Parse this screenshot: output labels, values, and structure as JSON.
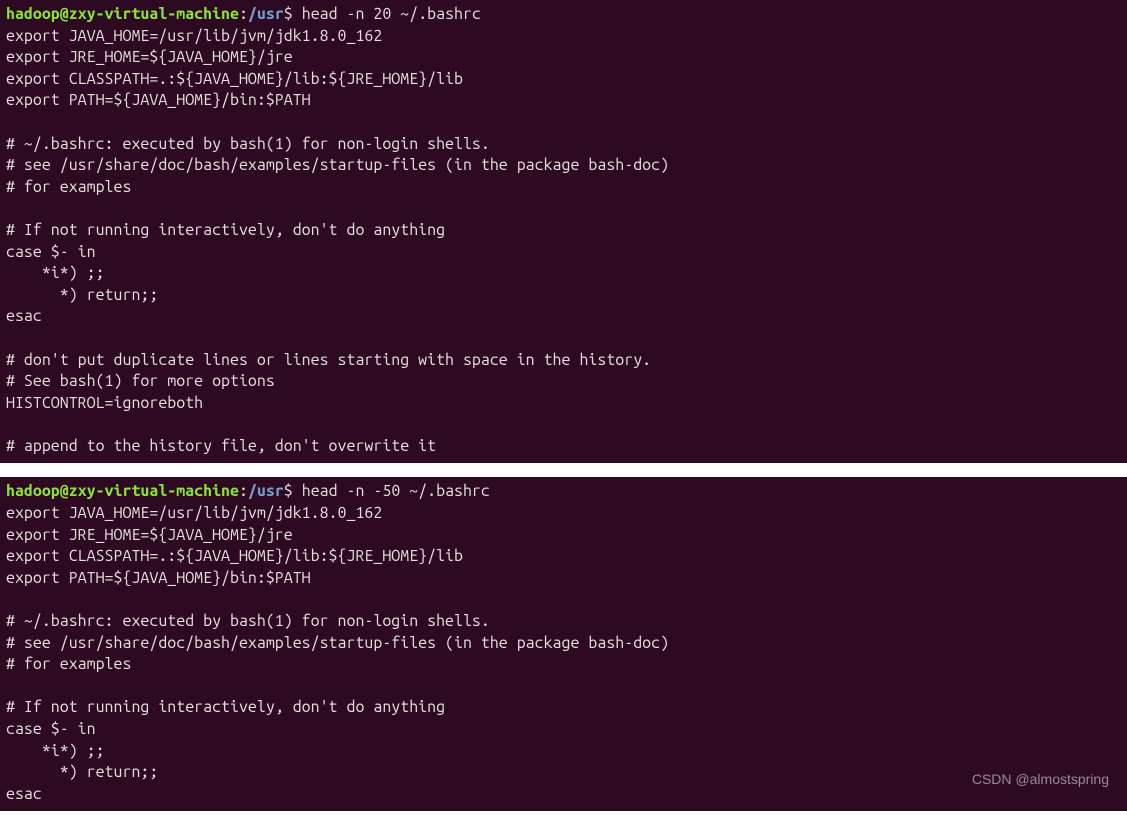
{
  "prompt": {
    "user": "hadoop",
    "at": "@",
    "host": "zxy-virtual-machine",
    "colon": ":",
    "path": "/usr",
    "dollar": "$"
  },
  "terminal1": {
    "command": "head -n 20 ~/.bashrc",
    "lines": [
      "export JAVA_HOME=/usr/lib/jvm/jdk1.8.0_162",
      "export JRE_HOME=${JAVA_HOME}/jre",
      "export CLASSPATH=.:${JAVA_HOME}/lib:${JRE_HOME}/lib",
      "export PATH=${JAVA_HOME}/bin:$PATH",
      "",
      "# ~/.bashrc: executed by bash(1) for non-login shells.",
      "# see /usr/share/doc/bash/examples/startup-files (in the package bash-doc)",
      "# for examples",
      "",
      "# If not running interactively, don't do anything",
      "case $- in",
      "    *i*) ;;",
      "      *) return;;",
      "esac",
      "",
      "# don't put duplicate lines or lines starting with space in the history.",
      "# See bash(1) for more options",
      "HISTCONTROL=ignoreboth",
      "",
      "# append to the history file, don't overwrite it"
    ]
  },
  "terminal2": {
    "command": "head -n -50 ~/.bashrc",
    "lines": [
      "export JAVA_HOME=/usr/lib/jvm/jdk1.8.0_162",
      "export JRE_HOME=${JAVA_HOME}/jre",
      "export CLASSPATH=.:${JAVA_HOME}/lib:${JRE_HOME}/lib",
      "export PATH=${JAVA_HOME}/bin:$PATH",
      "",
      "# ~/.bashrc: executed by bash(1) for non-login shells.",
      "# see /usr/share/doc/bash/examples/startup-files (in the package bash-doc)",
      "# for examples",
      "",
      "# If not running interactively, don't do anything",
      "case $- in",
      "    *i*) ;;",
      "      *) return;;",
      "esac"
    ]
  },
  "watermark": "CSDN @almostspring"
}
